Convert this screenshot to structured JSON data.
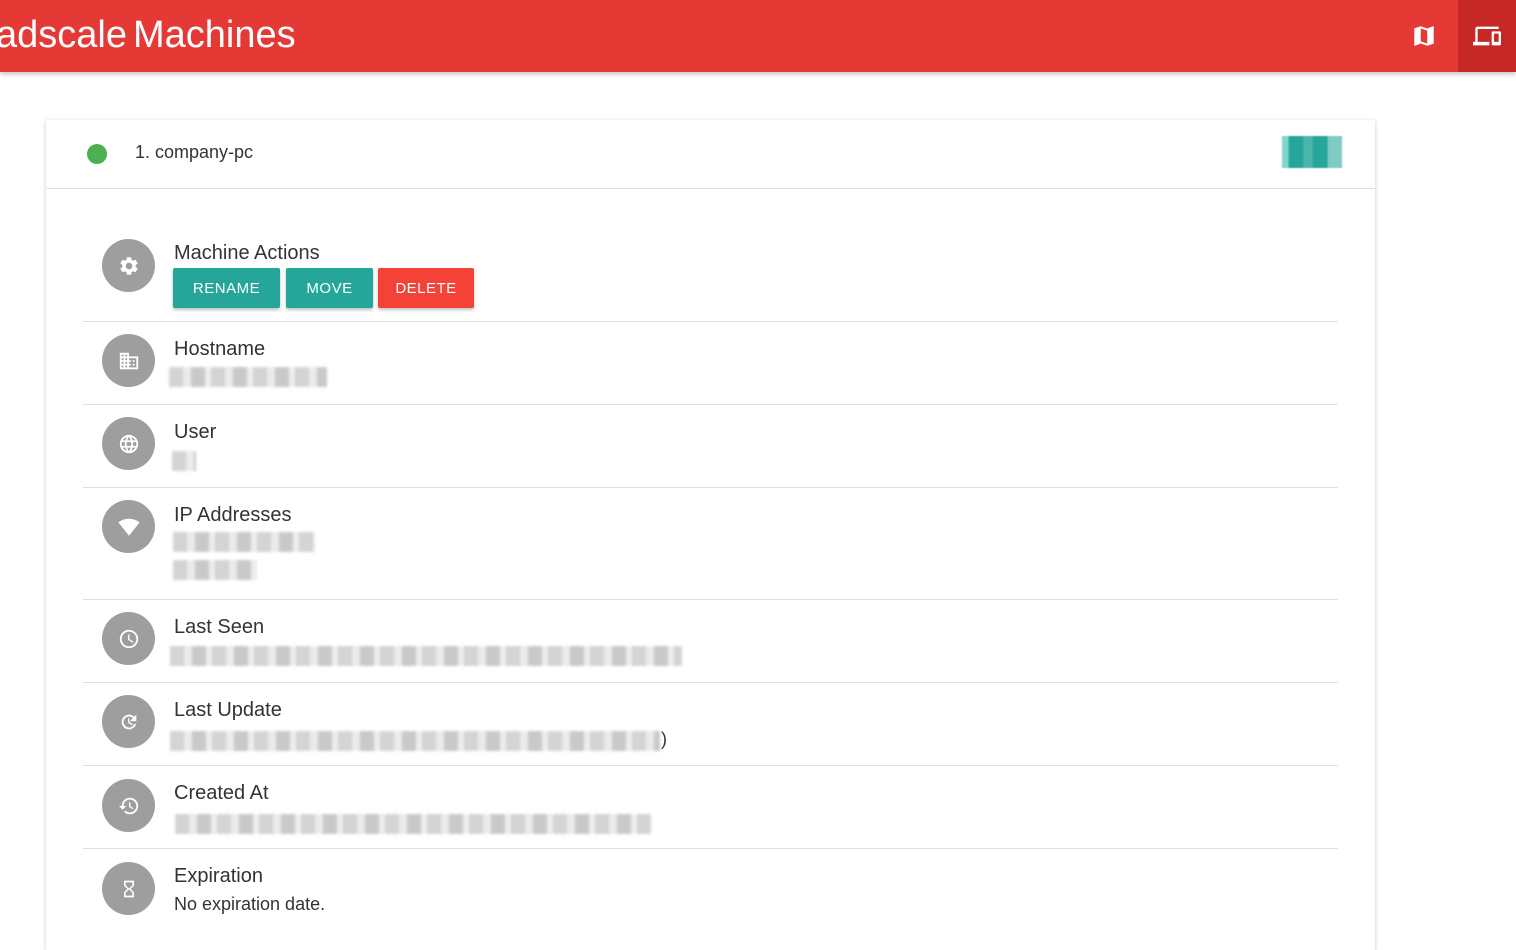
{
  "header": {
    "brand_part1": "adscale",
    "brand_part2": "Machines",
    "nav": [
      {
        "name": "map",
        "icon": "map-icon"
      },
      {
        "name": "machines",
        "icon": "devices-icon",
        "active": true
      }
    ],
    "color": "#e53935"
  },
  "machine": {
    "title": "1. company-pc",
    "status_color": "#4caf50",
    "online": true
  },
  "actions": {
    "title": "Machine Actions",
    "rename_label": "RENAME",
    "move_label": "MOVE",
    "delete_label": "DELETE"
  },
  "details": {
    "hostname": {
      "title": "Hostname"
    },
    "user": {
      "title": "User"
    },
    "ip_addresses": {
      "title": "IP Addresses"
    },
    "last_seen": {
      "title": "Last Seen"
    },
    "last_update": {
      "title": "Last Update",
      "tail": ")"
    },
    "created_at": {
      "title": "Created At"
    },
    "expiration": {
      "title": "Expiration",
      "value": "No expiration date."
    }
  }
}
